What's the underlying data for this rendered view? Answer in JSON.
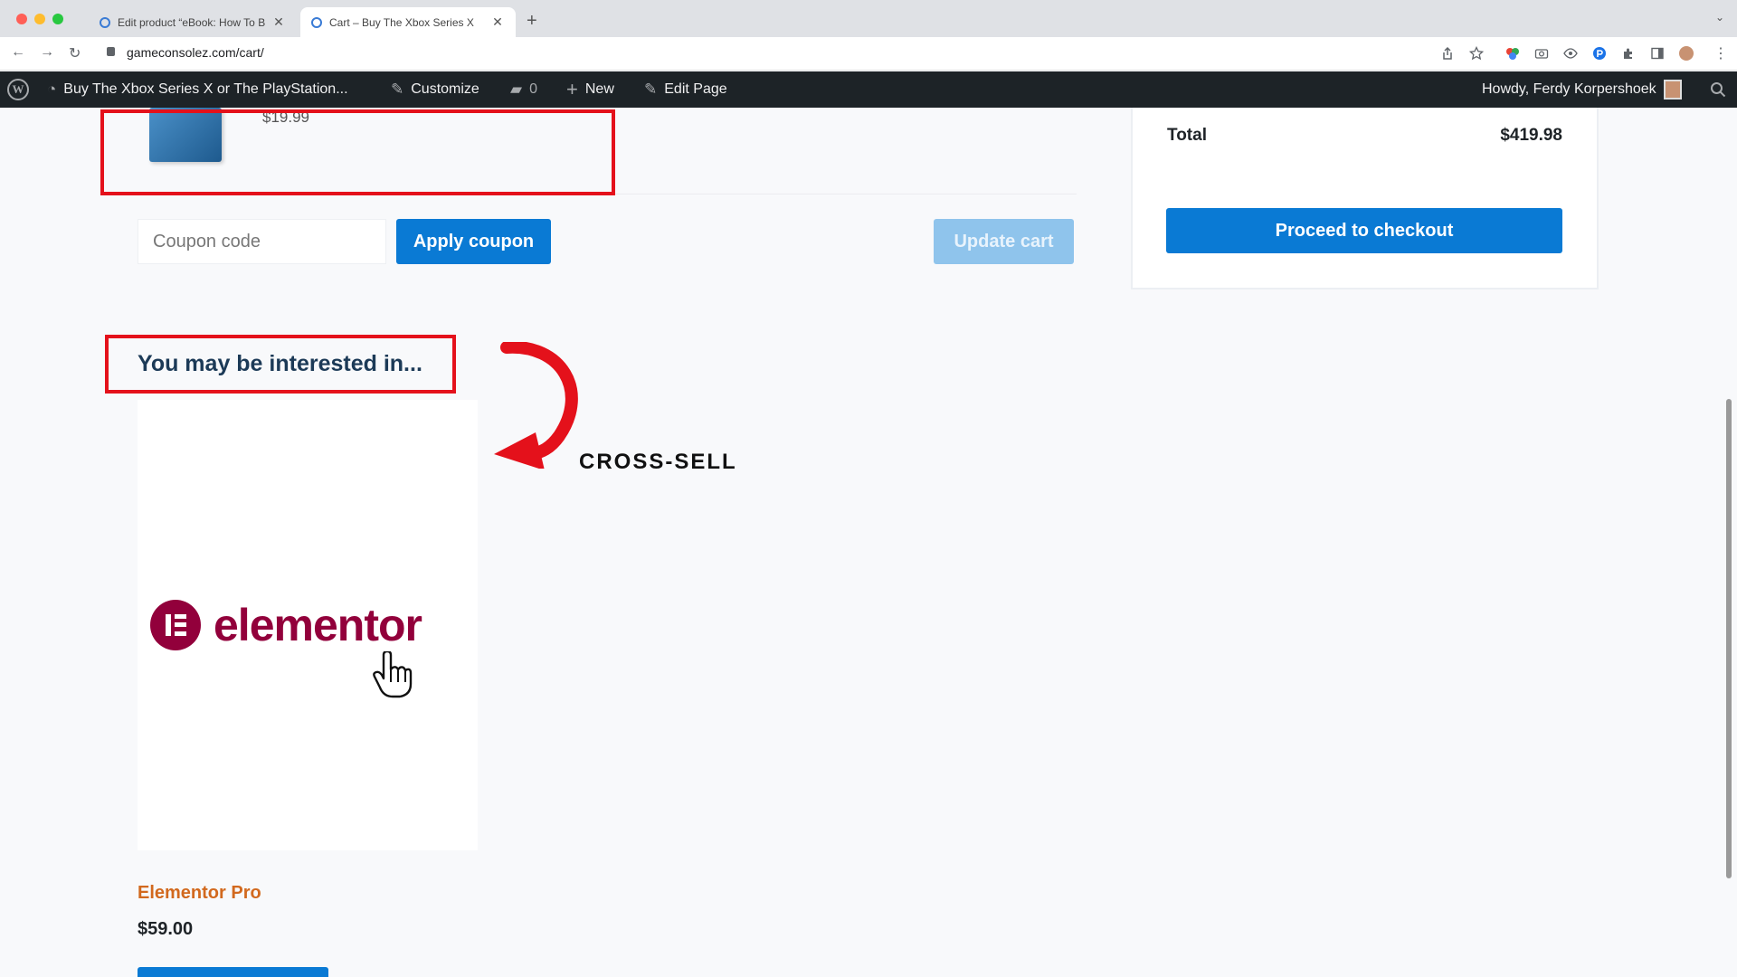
{
  "browser": {
    "tabs": [
      {
        "title": "Edit product “eBook: How To B",
        "active": false
      },
      {
        "title": "Cart – Buy The Xbox Series X",
        "active": true
      }
    ],
    "url": "gameconsolez.com/cart/"
  },
  "admin_bar": {
    "site_name": "Buy The Xbox Series X or The PlayStation...",
    "customize": "Customize",
    "comments_count": "0",
    "new": "New",
    "edit_page": "Edit Page",
    "howdy": "Howdy, Ferdy Korpershoek"
  },
  "cart": {
    "item_price": "$19.99",
    "coupon_placeholder": "Coupon code",
    "apply_coupon": "Apply coupon",
    "update_cart": "Update cart"
  },
  "totals": {
    "total_label": "Total",
    "total_value": "$419.98",
    "checkout": "Proceed to checkout"
  },
  "cross_sells": {
    "title": "You may be interested in...",
    "product": {
      "logo_text": "elementor",
      "name": "Elementor Pro",
      "price": "$59.00"
    }
  },
  "annotation": {
    "label": "CROSS-SELL",
    "color": "#e4111b"
  },
  "colors": {
    "primary_button": "#0a7ad4",
    "admin_bar": "#1d2327",
    "product_link": "#d2691e",
    "elementor_brand": "#92003b"
  }
}
